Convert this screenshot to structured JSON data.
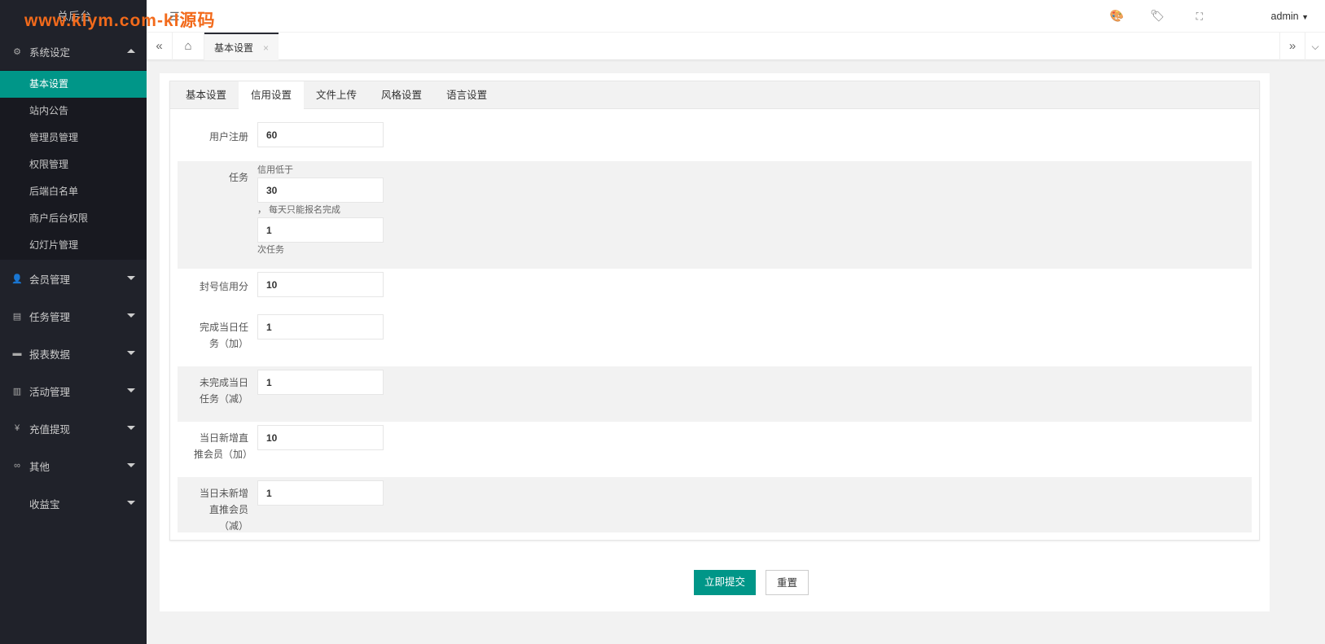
{
  "brand": {
    "logo": "总后台",
    "watermark": "www.klym.com-kl源码"
  },
  "sidebar": {
    "groups": [
      {
        "label": "系统设定",
        "icon": "gear-icon",
        "open": true,
        "items": [
          "基本设置",
          "站内公告",
          "管理员管理",
          "权限管理",
          "后端白名单",
          "商户后台权限",
          "幻灯片管理"
        ]
      },
      {
        "label": "会员管理",
        "icon": "user-icon"
      },
      {
        "label": "任务管理",
        "icon": "document-icon"
      },
      {
        "label": "报表数据",
        "icon": "chart-board-icon"
      },
      {
        "label": "活动管理",
        "icon": "book-icon"
      },
      {
        "label": "充值提现",
        "icon": "yen-icon"
      },
      {
        "label": "其他",
        "icon": "link-icon"
      },
      {
        "label": "收益宝",
        "icon": ""
      }
    ]
  },
  "header": {
    "user": "admin"
  },
  "tabbar": {
    "current": "基本设置",
    "close": "×"
  },
  "settings": {
    "tabs": [
      "基本设置",
      "信用设置",
      "文件上传",
      "风格设置",
      "语言设置"
    ],
    "active": 1
  },
  "form": {
    "register": {
      "label": "用户注册",
      "value": "60"
    },
    "task": {
      "label": "任务",
      "prefix": "信用低于",
      "value1": "30",
      "middle": "， 每天只能报名完成",
      "value2": "1",
      "suffix": "次任务"
    },
    "ban": {
      "label": "封号信用分",
      "value": "10"
    },
    "complete": {
      "label": "完成当日任务（加）",
      "value": "1"
    },
    "incomplete": {
      "label": "未完成当日任务（减）",
      "value": "1"
    },
    "newref": {
      "label": "当日新增直推会员（加）",
      "value": "10"
    },
    "nonewref": {
      "label": "当日未新增直推会员（减）",
      "value": "1"
    }
  },
  "buttons": {
    "submit": "立即提交",
    "reset": "重置"
  },
  "colors": {
    "accent": "#009688",
    "sidebar": "#20222a"
  }
}
